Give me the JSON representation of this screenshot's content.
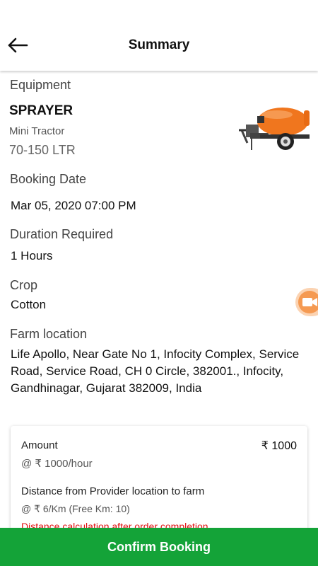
{
  "header": {
    "title": "Summary"
  },
  "equipment": {
    "label": "Equipment",
    "name": "SPRAYER",
    "type": "Mini Tractor",
    "capacity": "70-150 LTR"
  },
  "booking_date": {
    "label": "Booking Date",
    "value": "Mar 05, 2020 07:00 PM"
  },
  "duration": {
    "label": "Duration Required",
    "value": "1 Hours"
  },
  "crop": {
    "label": "Crop",
    "value": "Cotton"
  },
  "farm_location": {
    "label": "Farm location",
    "value": "Life Apollo, Near Gate No 1, Infocity Complex, Service Road, Service Road, CH 0 Circle, 382001., Infocity, Gandhinagar, Gujarat 382009, India"
  },
  "charges": {
    "amount_label": "Amount",
    "amount_value": "₹ 1000",
    "rate": "@ ₹ 1000/hour",
    "distance_label": "Distance from Provider location to farm",
    "distance_rate": "@ ₹ 6/Km (Free Km: 10)",
    "distance_note": "Distance calculation after order completion"
  },
  "actions": {
    "confirm_label": "Confirm Booking"
  },
  "colors": {
    "primary": "#14a338",
    "warning": "#e01010",
    "fab": "#f59a52"
  }
}
